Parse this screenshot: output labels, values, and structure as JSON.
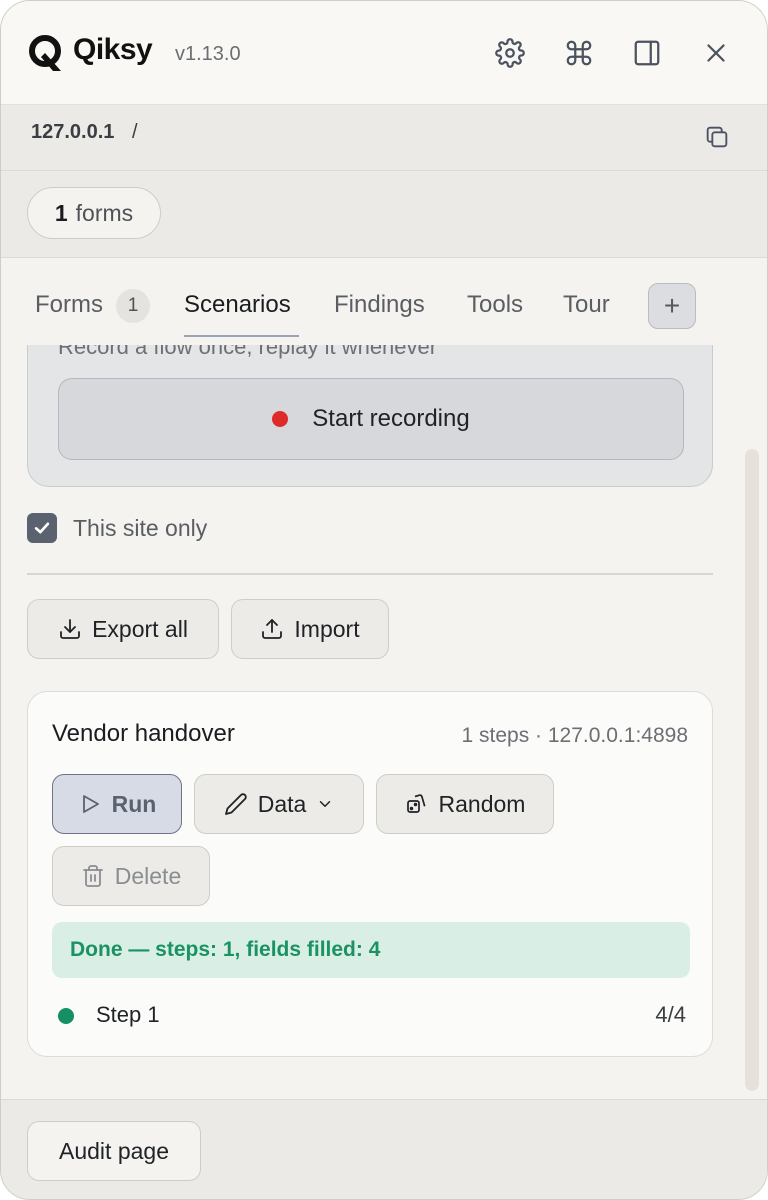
{
  "app": {
    "name": "Qiksy",
    "version": "v1.13.0"
  },
  "header_icons": [
    "gear-icon",
    "command-icon",
    "sidebar-toggle-icon",
    "close-icon"
  ],
  "url": {
    "host": "127.0.0.1",
    "path": "/"
  },
  "forms_chip": {
    "count": "1",
    "label": "forms"
  },
  "tabs": [
    {
      "label": "Forms",
      "badge": "1"
    },
    {
      "label": "Scenarios",
      "active": true
    },
    {
      "label": "Findings"
    },
    {
      "label": "Tools"
    },
    {
      "label": "Tour"
    }
  ],
  "add_tab_label": "+",
  "recorder": {
    "hint": "Record a flow once, replay it whenever",
    "start_label": "Start recording"
  },
  "site_only": {
    "label": "This site only",
    "checked": true
  },
  "actions": {
    "export_label": "Export all",
    "import_label": "Import"
  },
  "scenario": {
    "title": "Vendor handover",
    "meta": "1 steps · 127.0.0.1:4898",
    "run_label": "Run",
    "data_label": "Data",
    "random_label": "Random",
    "delete_label": "Delete",
    "status": "Done — steps: 1, fields filled: 4",
    "steps": [
      {
        "label": "Step 1",
        "count": "4/4"
      }
    ]
  },
  "footer": {
    "audit_label": "Audit page"
  },
  "colors": {
    "accent": "#5a6270",
    "record_dot": "#df2a2a",
    "success_text": "#1b9263",
    "success_bg": "#d9efe6",
    "step_dot": "#149064"
  }
}
